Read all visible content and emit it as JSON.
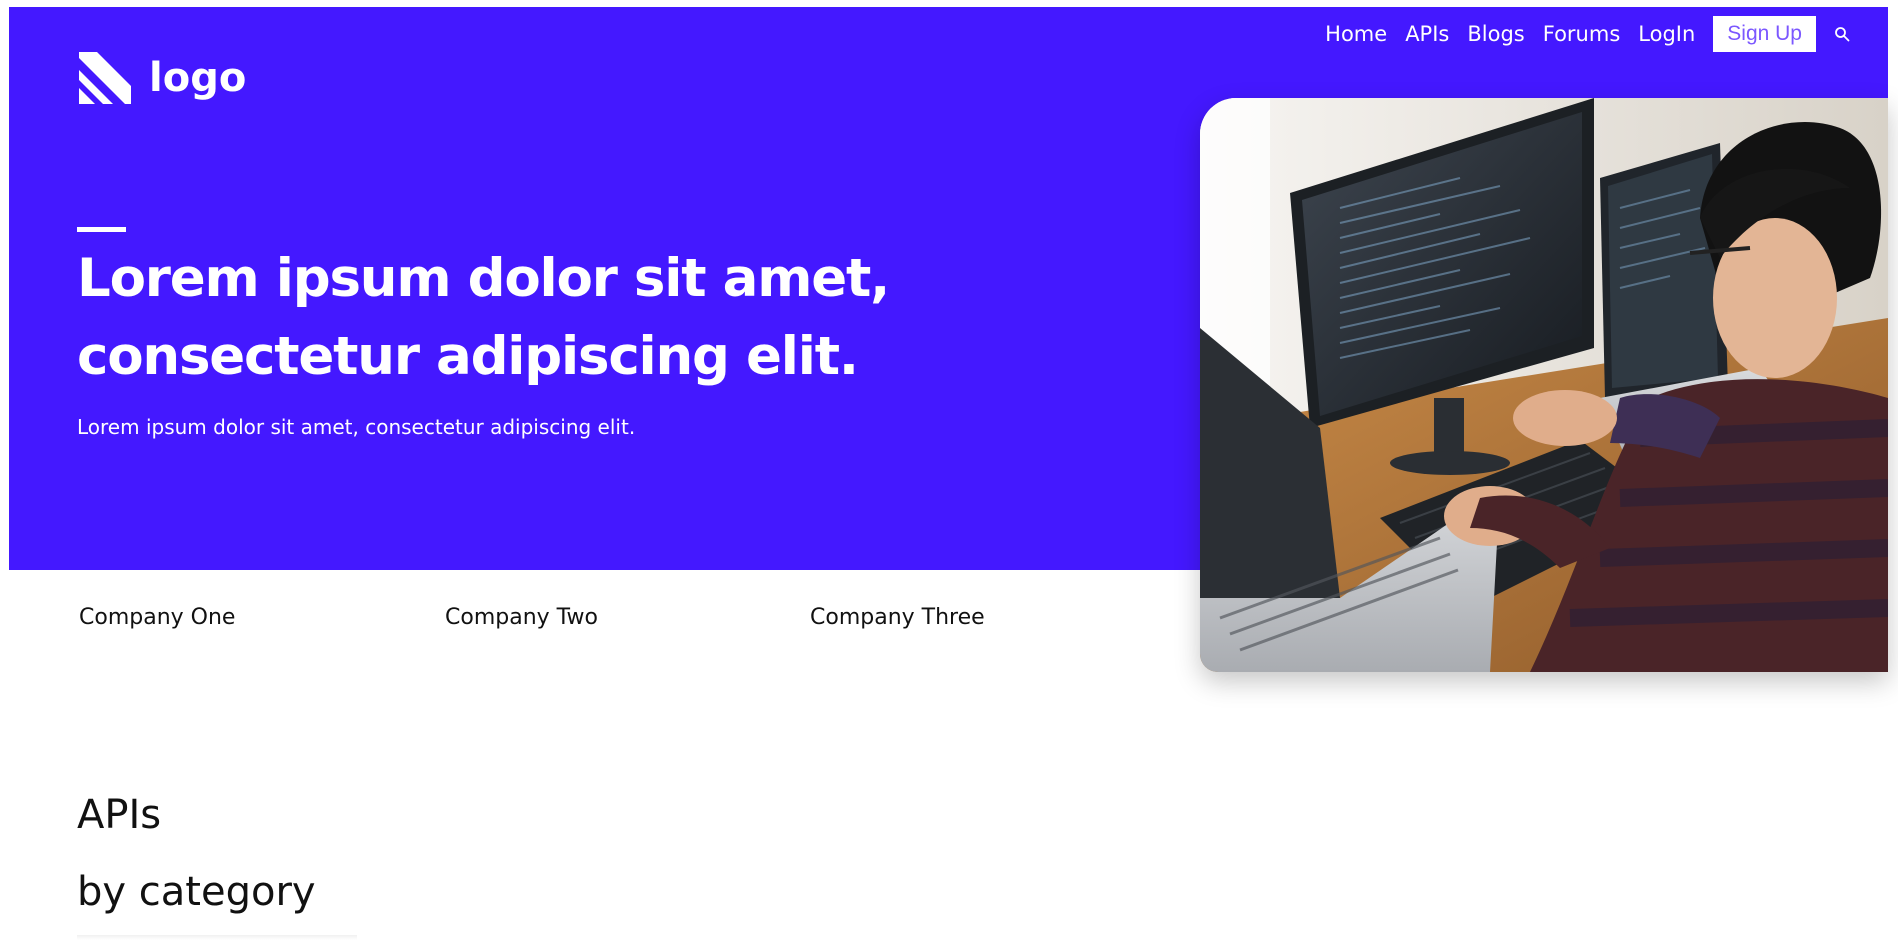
{
  "header": {
    "logo_text": "logo",
    "nav": {
      "home": "Home",
      "apis": "APIs",
      "blogs": "Blogs",
      "forums": "Forums",
      "login": "LogIn",
      "signup": "Sign Up"
    },
    "icons": {
      "logo": "logo-mark-icon",
      "search": "search-icon"
    }
  },
  "hero": {
    "headline_line1": "Lorem ipsum dolor sit amet,",
    "headline_line2": "consectetur adipiscing elit.",
    "subtext": "Lorem ipsum dolor sit amet, consectetur adipiscing elit.",
    "image_subject": "developer-at-computer-photo"
  },
  "companies": [
    "Company One",
    "Company Two",
    "Company Three"
  ],
  "section": {
    "title_line1": "APIs",
    "title_line2": "by category"
  },
  "colors": {
    "brand": "#4418ff",
    "signup_text": "#7b57ff",
    "text_dark": "#111111",
    "text_light": "#ffffff"
  }
}
